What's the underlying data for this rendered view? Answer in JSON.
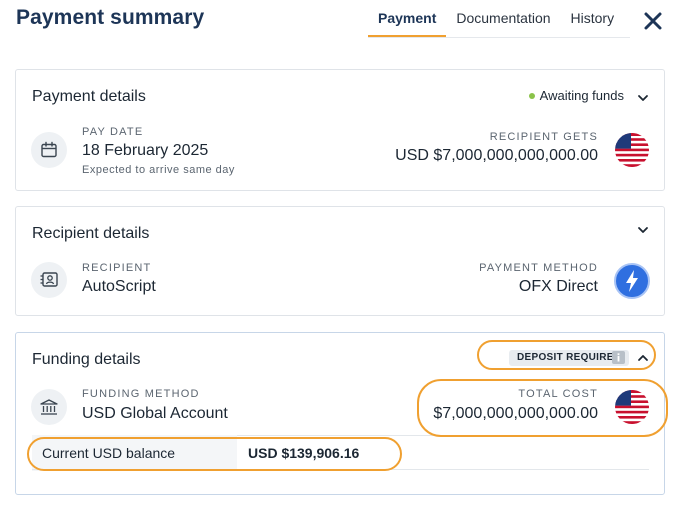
{
  "header": {
    "title": "Payment summary",
    "tabs": [
      {
        "label": "Payment",
        "active": true
      },
      {
        "label": "Documentation",
        "active": false
      },
      {
        "label": "History",
        "active": false
      }
    ],
    "close_icon": "close-icon"
  },
  "payment_details": {
    "title": "Payment details",
    "status": "Awaiting funds",
    "status_color": "#8bc34a",
    "pay_date_label": "PAY DATE",
    "pay_date_value": "18 February 2025",
    "pay_date_hint": "Expected to arrive same day",
    "recipient_gets_label": "RECIPIENT GETS",
    "recipient_gets_value": "USD $7,000,000,000,000.00"
  },
  "recipient_details": {
    "title": "Recipient details",
    "recipient_label": "RECIPIENT",
    "recipient_value": "AutoScript",
    "method_label": "PAYMENT METHOD",
    "method_value": "OFX Direct"
  },
  "funding_details": {
    "title": "Funding details",
    "badge": "DEPOSIT REQUIRED",
    "funding_method_label": "FUNDING METHOD",
    "funding_method_value": "USD Global Account",
    "total_cost_label": "TOTAL COST",
    "total_cost_value": "$7,000,000,000,000.00",
    "balance_label": "Current USD balance",
    "balance_value": "USD $139,906.16"
  },
  "colors": {
    "accent": "#f0a030",
    "brand": "#1d3557",
    "ofx_blue": "#2f6fe0"
  }
}
